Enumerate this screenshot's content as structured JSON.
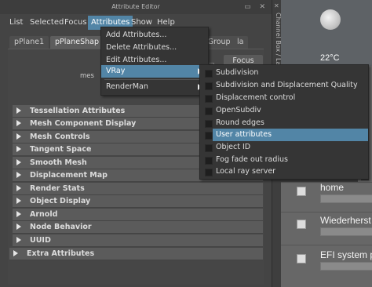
{
  "window": {
    "title": "Attribute Editor"
  },
  "menubar": [
    "List",
    "Selected",
    "Focus",
    "Attributes",
    "Show",
    "Help"
  ],
  "tabs": [
    "pPlane1",
    "pPlaneShap",
    "lgGroup",
    "la"
  ],
  "focus_label": "Focus",
  "mes_label": "mes",
  "sections": [
    "Tessellation Attributes",
    "Mesh Component Display",
    "Mesh Controls",
    "Tangent Space",
    "Smooth Mesh",
    "Displacement Map",
    "Render Stats",
    "Object Display",
    "Arnold",
    "Node Behavior",
    "UUID",
    "Extra Attributes"
  ],
  "attributes_menu": {
    "items": [
      "Add Attributes...",
      "Delete Attributes...",
      "Edit Attributes...",
      "VRay",
      "RenderMan"
    ],
    "highlighted": "VRay"
  },
  "vray_menu": {
    "items": [
      "Subdivision",
      "Subdivision and Displacement Quality",
      "Displacement control",
      "OpenSubdiv",
      "Round edges",
      "User attributes",
      "Object ID",
      "Fog fade out radius",
      "Local ray server"
    ],
    "highlighted": "User attributes"
  },
  "channel_box": {
    "label": "Channel Box / La"
  },
  "desktop": {
    "temperature": "22°C",
    "items": [
      "home",
      "Wiederherst",
      "EFI system p"
    ]
  },
  "colors": {
    "highlight": "#5285a6",
    "panel": "#444444",
    "section": "#5b5b5b"
  }
}
